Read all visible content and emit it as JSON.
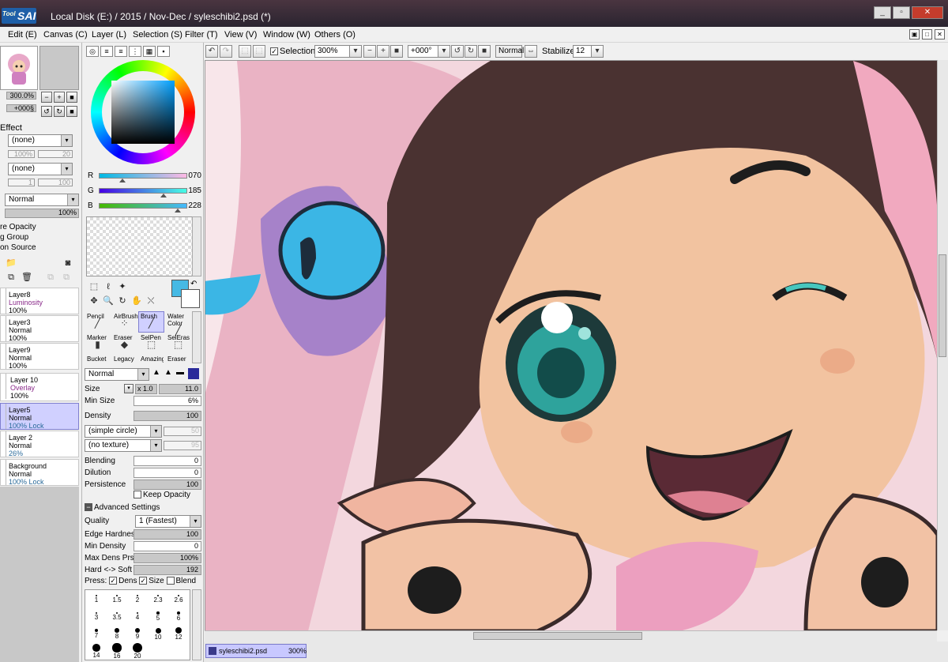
{
  "app": {
    "logo": "SAI",
    "logo_prefix": "Tool",
    "title": "Local Disk (E:) / 2015 / Nov-Dec / syleschibi2.psd (*)"
  },
  "window_controls": {
    "min": "_",
    "max": "▫",
    "close": "✕"
  },
  "menu": [
    "Edit (E)",
    "Canvas (C)",
    "Layer (L)",
    "Selection (S)",
    "Filter (T)",
    "View (V)",
    "Window (W)",
    "Others (O)"
  ],
  "toolbar": {
    "selection_label": "Selection",
    "zoom": "300%",
    "angle": "+000°",
    "blend_mode": "Normal",
    "stabilizer_label": "Stabilizer",
    "stabilizer_value": "12"
  },
  "navigator": {
    "zoom": "300.0%",
    "angle": "+000§"
  },
  "layer_panel": {
    "effect_label": "Effect",
    "texture_value": "(none)",
    "texture_pct": "100%",
    "texture_num": "20",
    "effect_value": "(none)",
    "effect_n1": "1",
    "effect_n2": "100",
    "blend_mode": "Normal",
    "opacity": "100%",
    "options": [
      "re Opacity",
      "g Group",
      "on Source"
    ],
    "layers": [
      {
        "name": "Layer8",
        "mode": "Luminosity",
        "opacity": "100%"
      },
      {
        "name": "Layer3",
        "mode": "Normal",
        "opacity": "100%"
      },
      {
        "name": "Layer9",
        "mode": "Normal",
        "opacity": "100%"
      },
      {
        "name": "Layer 10",
        "mode": "Overlay",
        "opacity": "100%"
      },
      {
        "name": "Layer5",
        "mode": "Normal",
        "opacity": "100% Lock"
      },
      {
        "name": "Layer 2",
        "mode": "Normal",
        "opacity": "26%"
      },
      {
        "name": "Background",
        "mode": "Normal",
        "opacity": "100% Lock"
      }
    ]
  },
  "color": {
    "r_label": "R",
    "g_label": "G",
    "b_label": "B",
    "r": "070",
    "g": "185",
    "b": "228",
    "r_frac": 0.27,
    "g_frac": 0.73,
    "b_frac": 0.89,
    "primary": "#46b9e4"
  },
  "brushes": [
    {
      "label": "Pencil",
      "icon": "pencil-icon"
    },
    {
      "label": "AirBrush",
      "icon": "airbrush-icon"
    },
    {
      "label": "Brush",
      "icon": "brush-icon"
    },
    {
      "label": "Water Color",
      "icon": "watercolor-icon"
    },
    {
      "label": "Marker",
      "icon": "marker-icon"
    },
    {
      "label": "Eraser",
      "icon": "eraser-icon"
    },
    {
      "label": "SelPen",
      "icon": "selpen-icon"
    },
    {
      "label": "SelEras",
      "icon": "seleras-icon"
    },
    {
      "label": "Bucket",
      "icon": "bucket-icon"
    },
    {
      "label": "Legacy",
      "icon": "legacy-icon"
    },
    {
      "label": "Amazing",
      "icon": "amazing-icon"
    },
    {
      "label": "Eraser",
      "icon": "eraser-icon"
    }
  ],
  "brush_settings": {
    "mode": "Normal",
    "size_label": "Size",
    "size_mult": "x 1.0",
    "size": "11.0",
    "min_size_label": "Min Size",
    "min_size": "6%",
    "density_label": "Density",
    "density": "100",
    "shape": "(simple circle)",
    "shape_val": "50",
    "texture": "(no texture)",
    "texture_val": "95",
    "blending_label": "Blending",
    "blending": "0",
    "dilution_label": "Dilution",
    "dilution": "0",
    "persistence_label": "Persistence",
    "persistence": "100",
    "keep_opacity": "Keep Opacity",
    "advanced": "Advanced Settings",
    "quality_label": "Quality",
    "quality": "1 (Fastest)",
    "edge_label": "Edge Hardness",
    "edge": "100",
    "min_density_label": "Min Density",
    "min_density": "0",
    "max_dens_label": "Max Dens Prs.",
    "max_dens": "100%",
    "hardsoft_label": "Hard <-> Soft",
    "hardsoft": "192",
    "press_label": "Press:",
    "press_dens": "Dens",
    "press_size": "Size",
    "press_blend": "Blend"
  },
  "brush_sizes": [
    "1",
    "1.5",
    "2",
    "2.3",
    "2.6",
    "3",
    "3.5",
    "4",
    "5",
    "6",
    "7",
    "8",
    "9",
    "10",
    "12",
    "14",
    "16",
    "20"
  ],
  "document_tab": {
    "name": "syleschibi2.psd",
    "zoom": "300%"
  }
}
